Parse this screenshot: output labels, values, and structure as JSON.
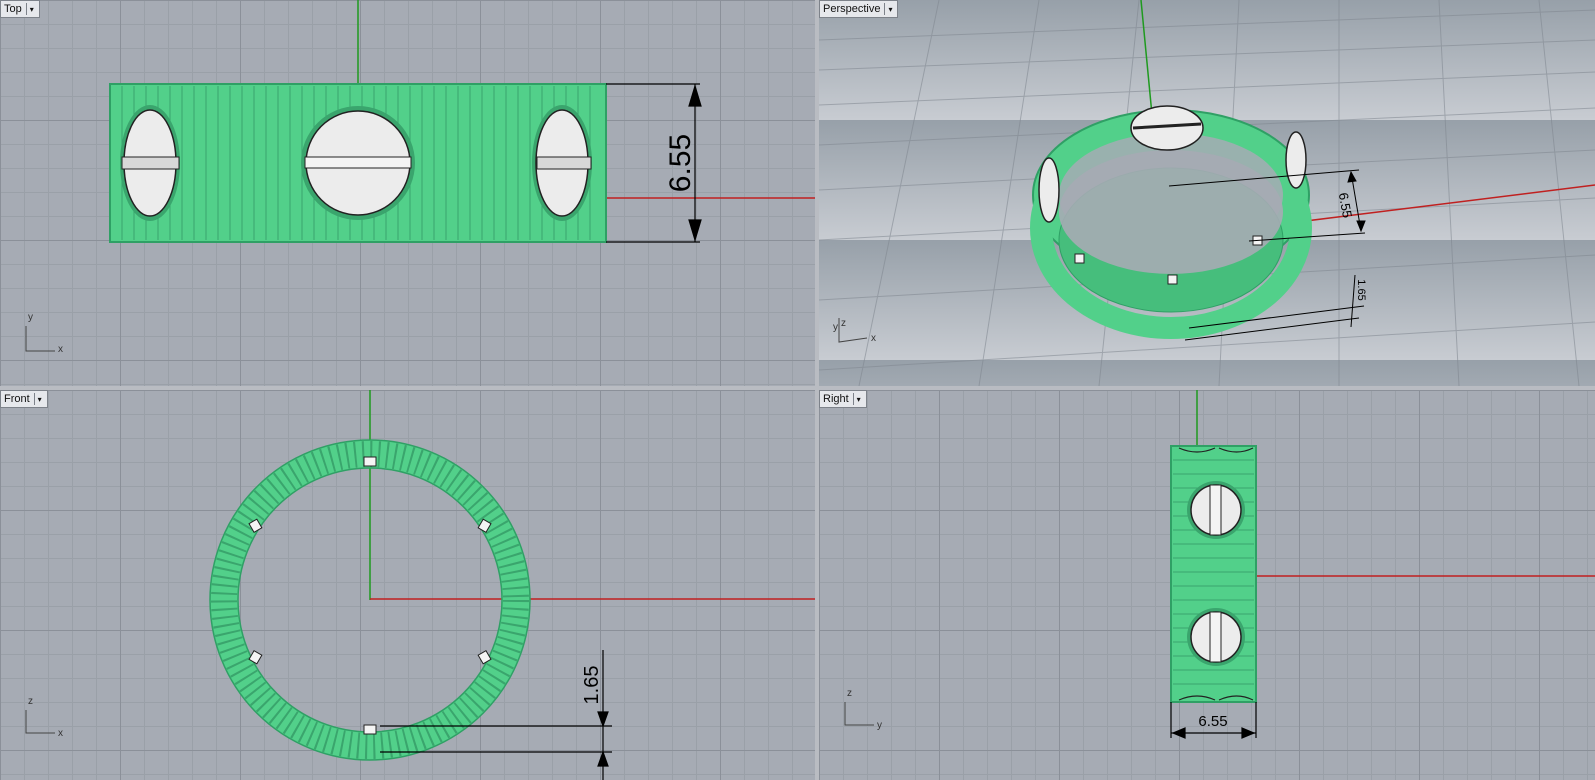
{
  "viewports": {
    "top": {
      "label": "Top",
      "dim_width": "6.55",
      "axis_x": "x",
      "axis_y": "y"
    },
    "perspective": {
      "label": "Perspective",
      "dim_width": "6.55",
      "dim_thickness": "1.65",
      "axis_x": "x",
      "axis_y": "y",
      "axis_z": "z"
    },
    "front": {
      "label": "Front",
      "dim_thickness": "1.65",
      "axis_x": "x",
      "axis_z": "z"
    },
    "right": {
      "label": "Right",
      "dim_width": "6.55",
      "axis_y": "y",
      "axis_z": "z"
    }
  },
  "colors": {
    "ring": "#52d08a",
    "grid_bg": "#a6abb4",
    "x_axis": "#c02020",
    "y_axis": "#1f9a1f"
  },
  "icons": {
    "viewport_menu": "dropdown-arrow-icon"
  }
}
